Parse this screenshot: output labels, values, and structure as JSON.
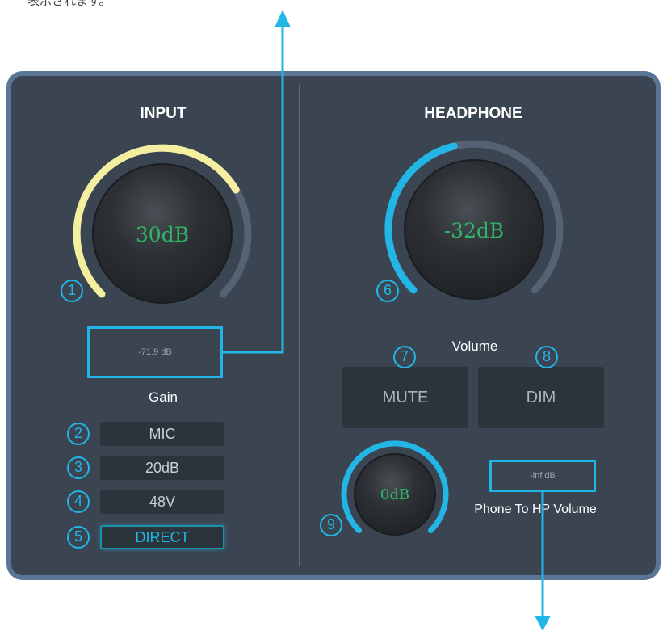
{
  "caption_top": "表示されます。",
  "input": {
    "title": "INPUT",
    "gain_knob": {
      "value": "30dB",
      "level": 0.72
    },
    "meter": "-71.9 dB",
    "gain_label": "Gain",
    "buttons": [
      {
        "badge": "2",
        "label": "MIC",
        "active": false
      },
      {
        "badge": "3",
        "label": "20dB",
        "active": false
      },
      {
        "badge": "4",
        "label": "48V",
        "active": false
      },
      {
        "badge": "5",
        "label": "DIRECT",
        "active": true
      }
    ],
    "knob_badge": "1"
  },
  "headphone": {
    "title": "HEADPHONE",
    "volume_knob": {
      "value": "-32dB",
      "level": 0.45
    },
    "knob_badge": "6",
    "volume_label": "Volume",
    "mute": {
      "badge": "7",
      "label": "MUTE"
    },
    "dim": {
      "badge": "8",
      "label": "DIM"
    },
    "phone_knob": {
      "value": "0dB",
      "level": 1.0
    },
    "phone_badge": "9",
    "phone_meter": "-inf dB",
    "phone_label": "Phone To HP Volume"
  },
  "colors": {
    "panel_bg": "#3b4552",
    "panel_border": "#5a7596",
    "accent_blue": "#21b6e6",
    "gain_arc": "#f4eea0",
    "value_green": "#2fb467"
  }
}
